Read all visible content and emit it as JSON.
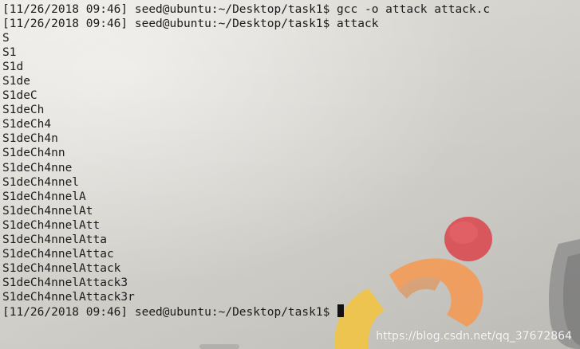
{
  "terminal": {
    "lines": [
      {
        "prompt": "[11/26/2018 09:46] seed@ubuntu:~/Desktop/task1$",
        "command": "gcc -o attack attack.c"
      },
      {
        "prompt": "[11/26/2018 09:46] seed@ubuntu:~/Desktop/task1$",
        "command": "attack"
      }
    ],
    "output": [
      "S",
      "S1",
      "S1d",
      "S1de",
      "S1deC",
      "S1deCh",
      "S1deCh4",
      "S1deCh4n",
      "S1deCh4nn",
      "S1deCh4nne",
      "S1deCh4nnel",
      "S1deCh4nnelA",
      "S1deCh4nnelAt",
      "S1deCh4nnelAtt",
      "S1deCh4nnelAtta",
      "S1deCh4nnelAttac",
      "S1deCh4nnelAttack",
      "S1deCh4nnelAttack3",
      "S1deCh4nnelAttack3r"
    ],
    "final_prompt": "[11/26/2018 09:46] seed@ubuntu:~/Desktop/task1$"
  },
  "watermark": "https://blog.csdn.net/qq_37672864",
  "colors": {
    "text": "#1b1b1b",
    "logo_orange": "#f39a55",
    "logo_red": "#d9484e",
    "logo_yellow": "#f0c44a"
  }
}
